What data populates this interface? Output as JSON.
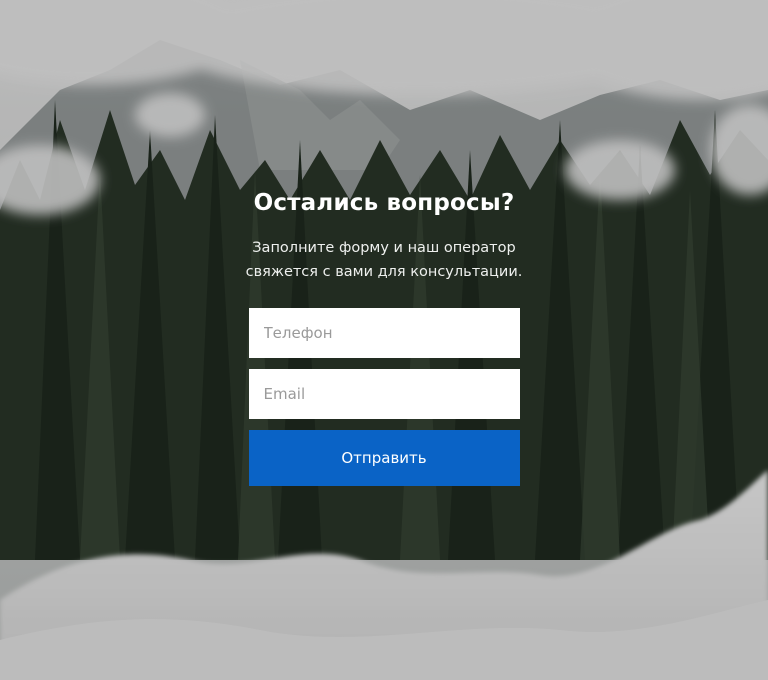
{
  "section": {
    "title": "Остались вопросы?",
    "subtitle_line1": "Заполните форму и наш оператор",
    "subtitle_line2": "свяжется с вами для консультации."
  },
  "form": {
    "phone_placeholder": "Телефон",
    "phone_value": "",
    "email_placeholder": "Email",
    "email_value": "",
    "submit_label": "Отправить"
  },
  "colors": {
    "button": "#0a63c6",
    "text": "#ffffff"
  }
}
